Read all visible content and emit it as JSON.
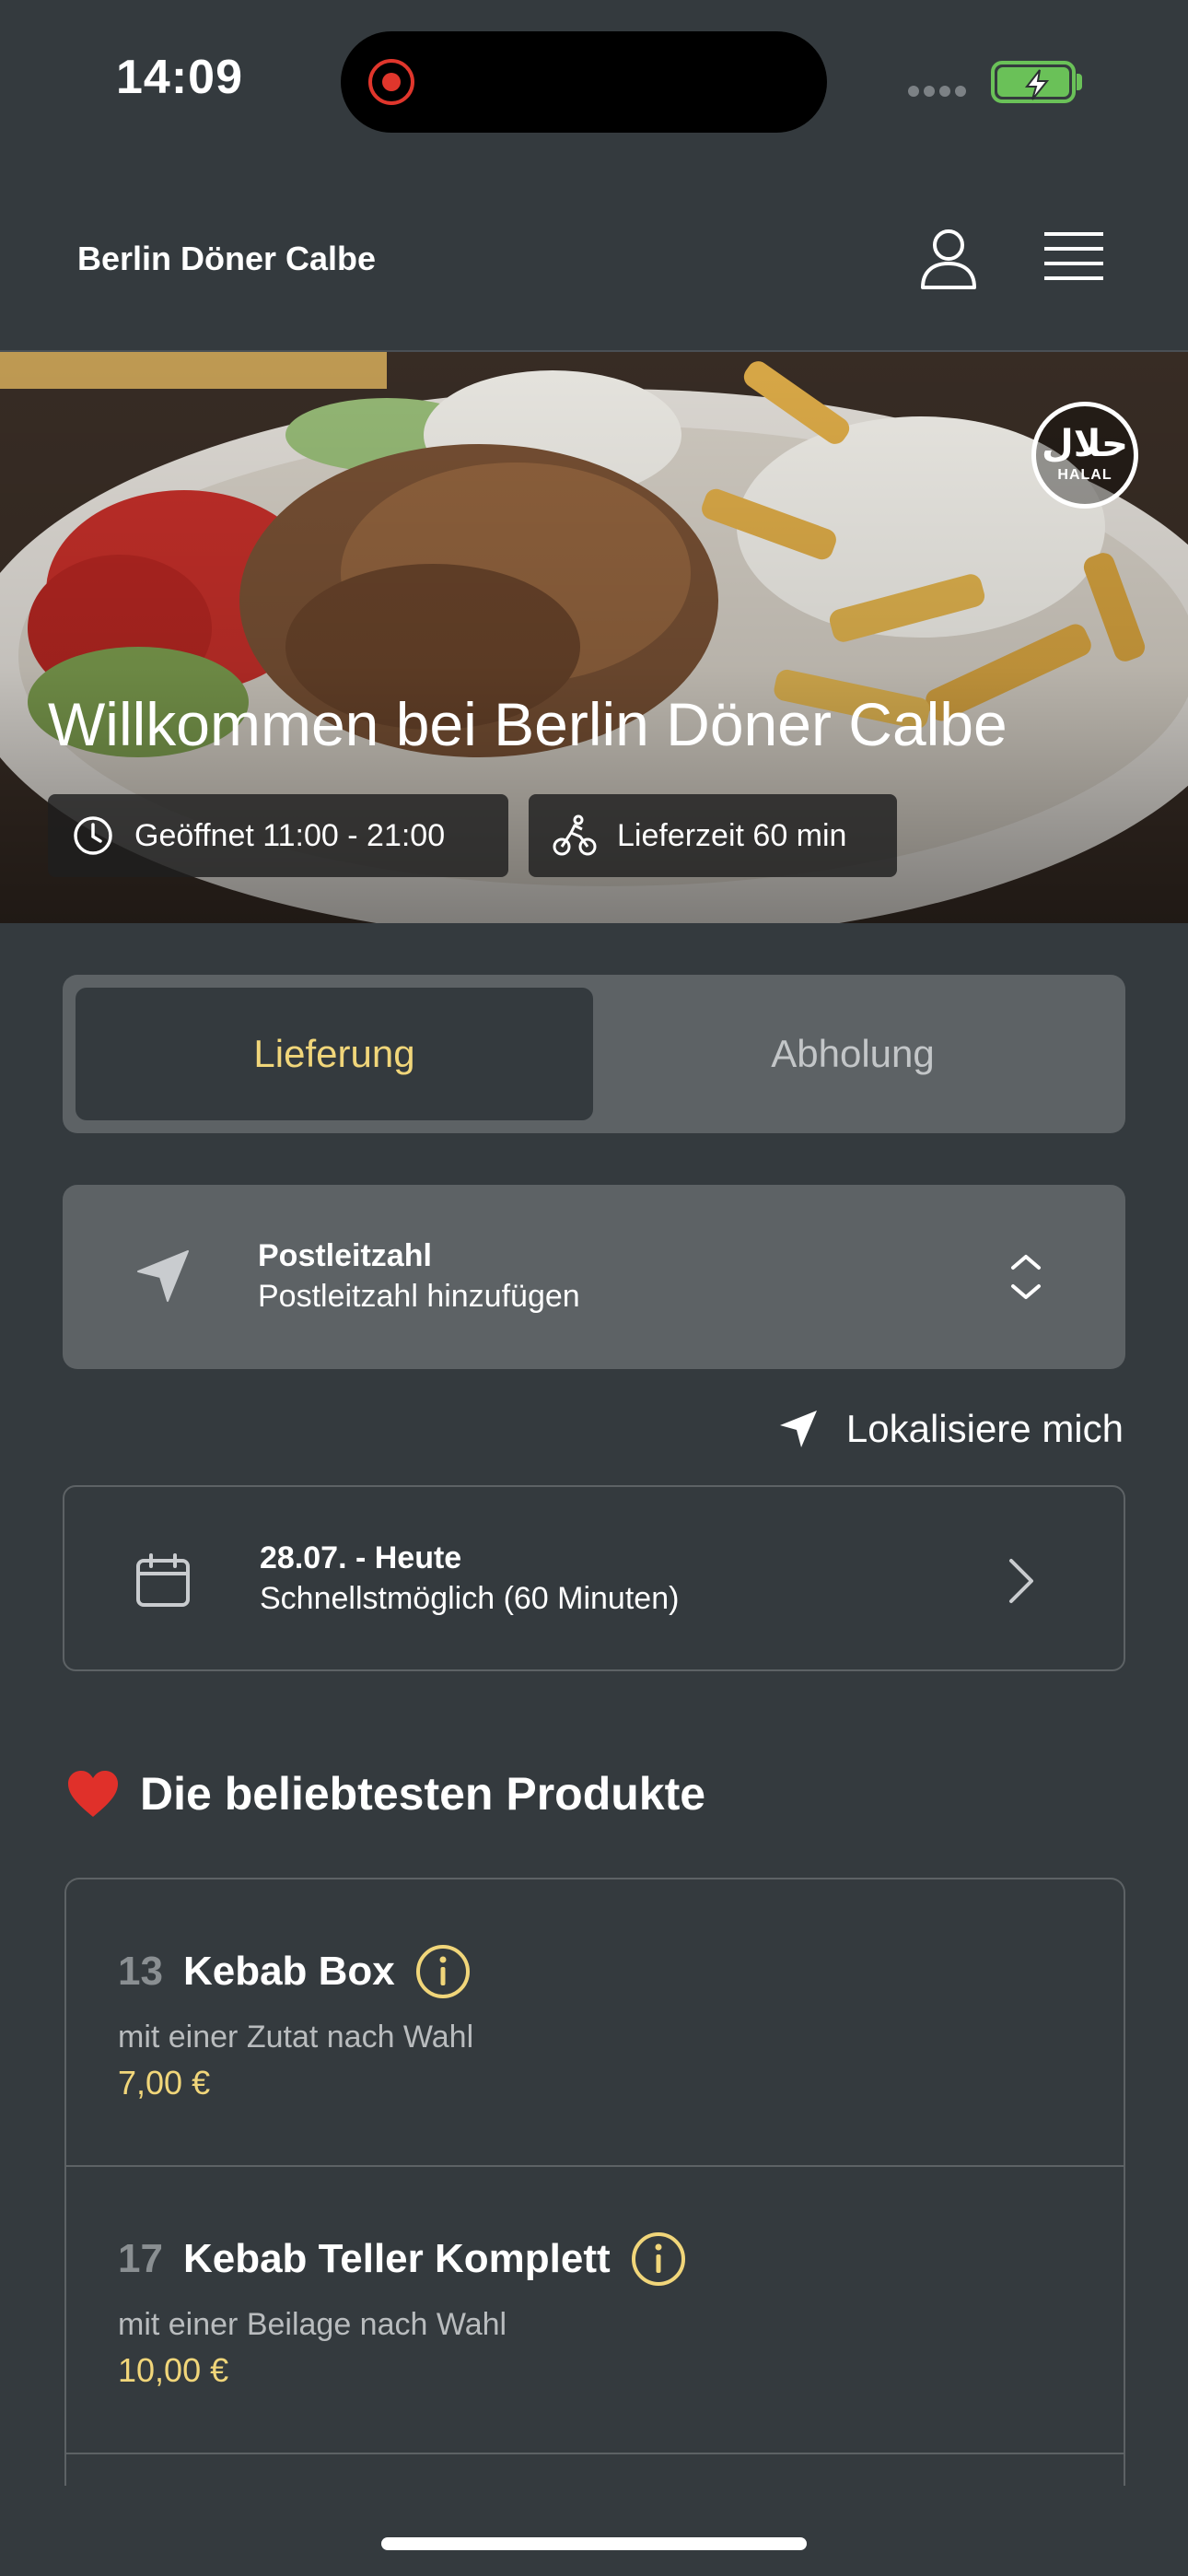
{
  "status_bar": {
    "time": "14:09"
  },
  "header": {
    "brand": "Berlin Döner Calbe"
  },
  "hero": {
    "title": "Willkommen bei Berlin Döner Calbe",
    "halal_arabic": "حلال",
    "halal_label": "HALAL",
    "opening_hours": "Geöffnet 11:00 - 21:00",
    "delivery_time": "Lieferzeit 60 min"
  },
  "order_mode": {
    "options": [
      "Lieferung",
      "Abholung"
    ],
    "selected": "Lieferung"
  },
  "postcode": {
    "title": "Postleitzahl",
    "placeholder": "Postleitzahl hinzufügen"
  },
  "locate_me": "Lokalisiere mich",
  "schedule": {
    "date": "28.07. - Heute",
    "time": "Schnellstmöglich (60 Minuten)"
  },
  "popular": {
    "title": "Die beliebtesten Produkte",
    "products": [
      {
        "number": "13",
        "name": "Kebab Box",
        "description": "mit einer Zutat nach Wahl",
        "price": "7,00 €"
      },
      {
        "number": "17",
        "name": "Kebab Teller Komplett",
        "description": "mit einer Beilage nach Wahl",
        "price": "10,00 €"
      }
    ]
  },
  "colors": {
    "background": "#343a3e",
    "surface": "#5d6265",
    "accent": "#f1d67a",
    "battery": "#6ac158",
    "recording": "#e0362c"
  },
  "icons": [
    "recording-icon",
    "battery-icon",
    "user-icon",
    "menu-icon",
    "clock-icon",
    "bicycle-icon",
    "navigation-arrow-icon",
    "up-down-chevron-icon",
    "calendar-icon",
    "chevron-right-icon",
    "heart-icon",
    "info-icon"
  ]
}
